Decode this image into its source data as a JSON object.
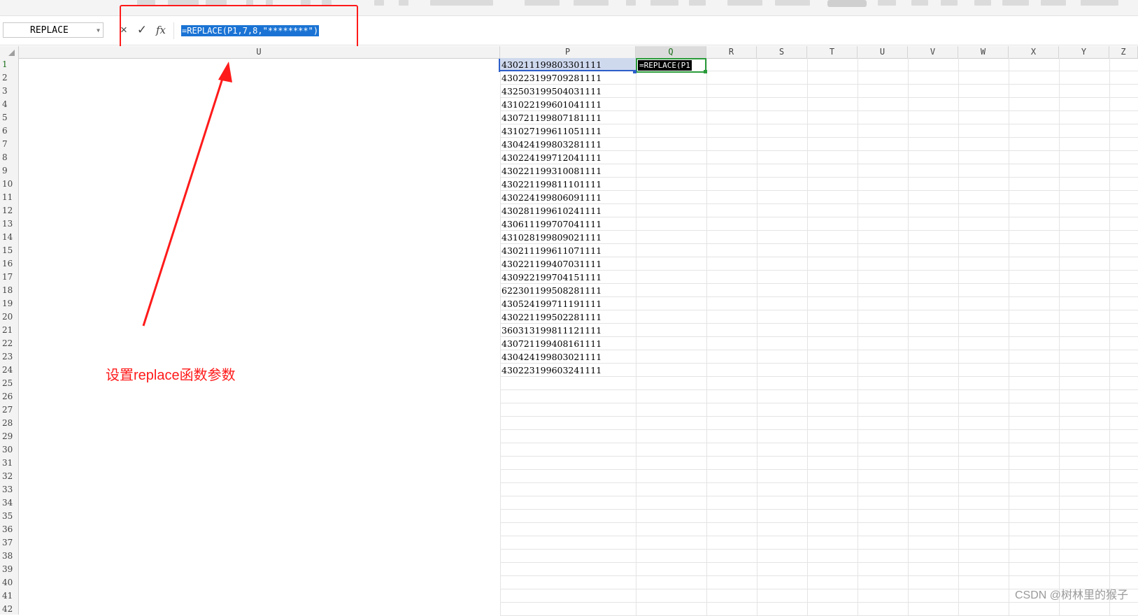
{
  "formula_bar": {
    "name_box": "REPLACE",
    "cancel_icon": "×",
    "confirm_icon": "✓",
    "fx_label": "fx",
    "formula": "=REPLACE(P1,7,8,\"********\")"
  },
  "columns": [
    "U",
    "P",
    "Q",
    "R",
    "S",
    "T",
    "U",
    "V",
    "W",
    "X",
    "Y",
    "Z"
  ],
  "rows": [
    "1",
    "2",
    "3",
    "4",
    "5",
    "6",
    "7",
    "8",
    "9",
    "10",
    "11",
    "12",
    "13",
    "14",
    "15",
    "16",
    "17",
    "18",
    "19",
    "20",
    "21",
    "22",
    "23",
    "24",
    "25",
    "26",
    "27",
    "28",
    "29",
    "30",
    "31",
    "32",
    "33",
    "34",
    "35",
    "36",
    "37",
    "38",
    "39",
    "40",
    "41",
    "42"
  ],
  "column_p": [
    "430211199803301111",
    "430223199709281111",
    "432503199504031111",
    "431022199601041111",
    "430721199807181111",
    "431027199611051111",
    "430424199803281111",
    "430224199712041111",
    "430221199310081111",
    "430221199811101111",
    "430224199806091111",
    "430281199610241111",
    "430611199707041111",
    "431028199809021111",
    "430211199611071111",
    "430221199407031111",
    "430922199704151111",
    "622301199508281111",
    "430524199711191111",
    "430221199502281111",
    "360313199811121111",
    "430721199408161111",
    "430424199803021111",
    "430223199603241111"
  ],
  "active_cell_text": "=REPLACE(P1",
  "annotation": "设置replace函数参数",
  "watermark": "CSDN @树林里的猴子",
  "colors": {
    "accent_red": "#ff1a1a",
    "selection_blue": "#1a73d4",
    "active_green": "#2a9b3a"
  }
}
